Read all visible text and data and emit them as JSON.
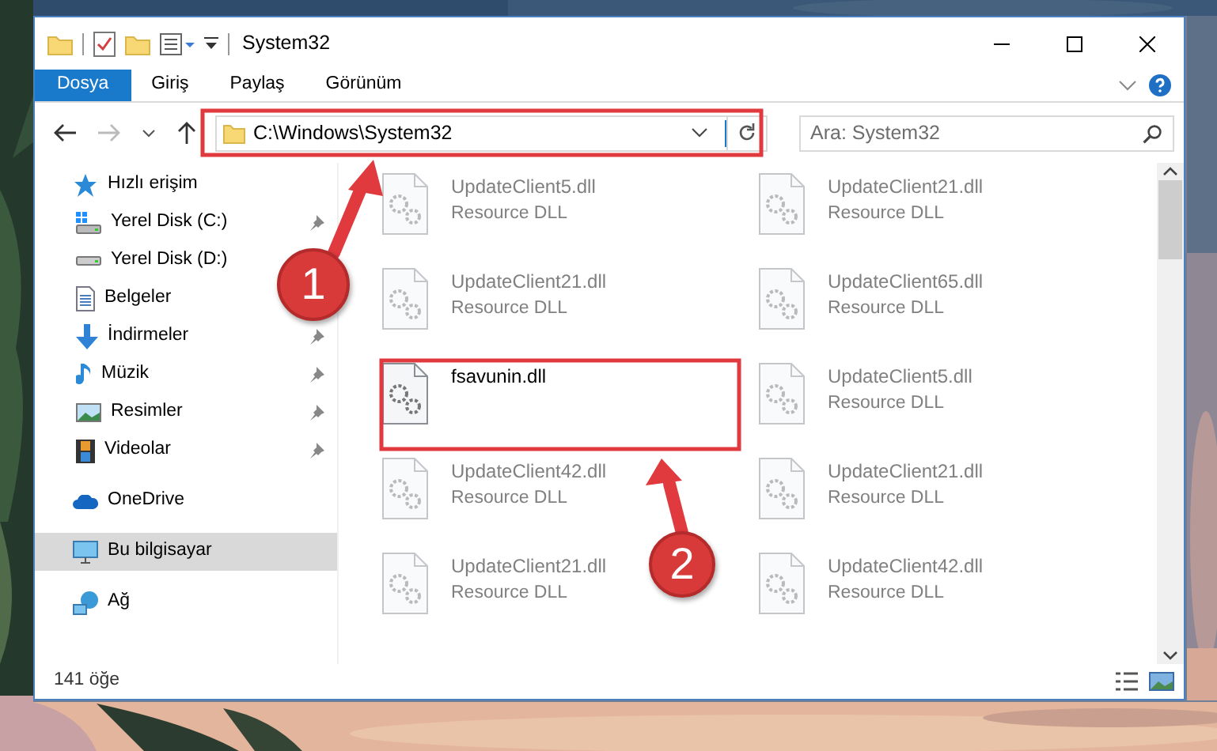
{
  "window": {
    "title": "System32"
  },
  "ribbon_tabs": [
    {
      "label": "Dosya",
      "kind": "file"
    },
    {
      "label": "Giriş",
      "kind": "tab"
    },
    {
      "label": "Paylaş",
      "kind": "tab"
    },
    {
      "label": "Görünüm",
      "kind": "tab"
    }
  ],
  "address": {
    "path": "C:\\Windows\\System32"
  },
  "search": {
    "placeholder": "Ara: System32"
  },
  "navigation": [
    {
      "label": "Hızlı erişim",
      "kind": "star",
      "selected": false,
      "pinned": false,
      "children": [
        {
          "label": "Yerel Disk (C:)",
          "kind": "drive-win",
          "selected": false,
          "pinned": true
        },
        {
          "label": "Yerel Disk (D:)",
          "kind": "drive",
          "selected": false,
          "pinned": false
        },
        {
          "label": "Belgeler",
          "kind": "docs",
          "selected": false,
          "pinned": false
        },
        {
          "label": "İndirmeler",
          "kind": "download",
          "selected": false,
          "pinned": true
        },
        {
          "label": "Müzik",
          "kind": "music",
          "selected": false,
          "pinned": true
        },
        {
          "label": "Resimler",
          "kind": "pictures",
          "selected": false,
          "pinned": true
        },
        {
          "label": "Videolar",
          "kind": "videos",
          "selected": false,
          "pinned": true
        }
      ]
    },
    {
      "label": "OneDrive",
      "kind": "cloud",
      "selected": false,
      "pinned": false
    },
    {
      "label": "Bu bilgisayar",
      "kind": "pc",
      "selected": true,
      "pinned": false
    },
    {
      "label": "Ağ",
      "kind": "network",
      "selected": false,
      "pinned": false
    }
  ],
  "files": [
    {
      "name": "UpdateClient5.dll",
      "type": "Resource DLL",
      "highlighted": false
    },
    {
      "name": "UpdateClient21.dll",
      "type": "Resource DLL",
      "highlighted": false
    },
    {
      "name": "UpdateClient21.dll",
      "type": "Resource DLL",
      "highlighted": false
    },
    {
      "name": "UpdateClient65.dll",
      "type": "Resource DLL",
      "highlighted": false
    },
    {
      "name": "fsavunin.dll",
      "highlighted": true
    },
    {
      "name": "UpdateClient5.dll",
      "type": "Resource DLL",
      "highlighted": false
    },
    {
      "name": "UpdateClient42.dll",
      "type": "Resource DLL",
      "highlighted": false
    },
    {
      "name": "UpdateClient21.dll",
      "type": "Resource DLL",
      "highlighted": false
    },
    {
      "name": "UpdateClient21.dll",
      "type": "Resource DLL",
      "highlighted": false
    },
    {
      "name": "UpdateClient42.dll",
      "type": "Resource DLL",
      "highlighted": false
    }
  ],
  "status_bar": {
    "item_count": "141 öğe"
  },
  "annotations": [
    {
      "number": "1"
    },
    {
      "number": "2"
    }
  ]
}
